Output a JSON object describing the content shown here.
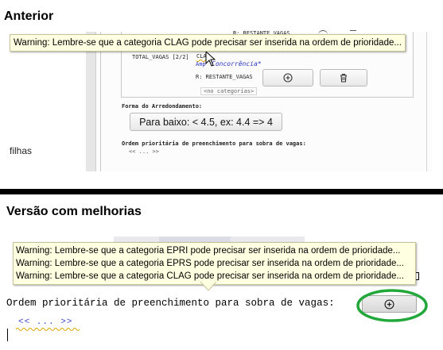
{
  "before": {
    "title": "Anterior",
    "tooltip": "Warning: Lembre-se que a categoria CLAG pode precisar ser inserida na ordem de prioridade...",
    "restante_top": "R: RESTANTE_VAGAS",
    "total_vagas": "TOTAL_VAGAS [2/2]",
    "clag": "CLA",
    "ampla": "Amp",
    "concorrencia": "Concorrência*",
    "restante": "R: RESTANTE_VAGAS",
    "no_categories": "<no categorias>",
    "rounding_label": "Forma do Arredondamento:",
    "rounding_value": "Para baixo: < 4.5, ex: 4.4 => 4",
    "priority_label": "Ordem prioritária de preenchimento para sobra de vagas:",
    "priority_value": "<< ... >>",
    "filhas": "filhas"
  },
  "after": {
    "title": "Versão com melhorias",
    "warnings": [
      "Warning: Lembre-se que a categoria EPRI pode precisar ser inserida na ordem de prioridade...",
      "Warning: Lembre-se que a categoria EPRS pode precisar ser inserida na ordem de prioridade...",
      "Warning: Lembre-se que a categoria CLAG pode precisar ser inserida na ordem de prioridade..."
    ],
    "priority_label": "Ordem prioritária de preenchimento para sobra de vagas:",
    "priority_value": "<< ... >>"
  },
  "icons": {
    "add": "plus-circle-icon",
    "delete": "trash-icon"
  },
  "colors": {
    "tooltip_bg": "#ffffe1",
    "highlight_ellipse": "#22a83a",
    "link": "#2a34c4",
    "squiggle": "#e0a400"
  }
}
